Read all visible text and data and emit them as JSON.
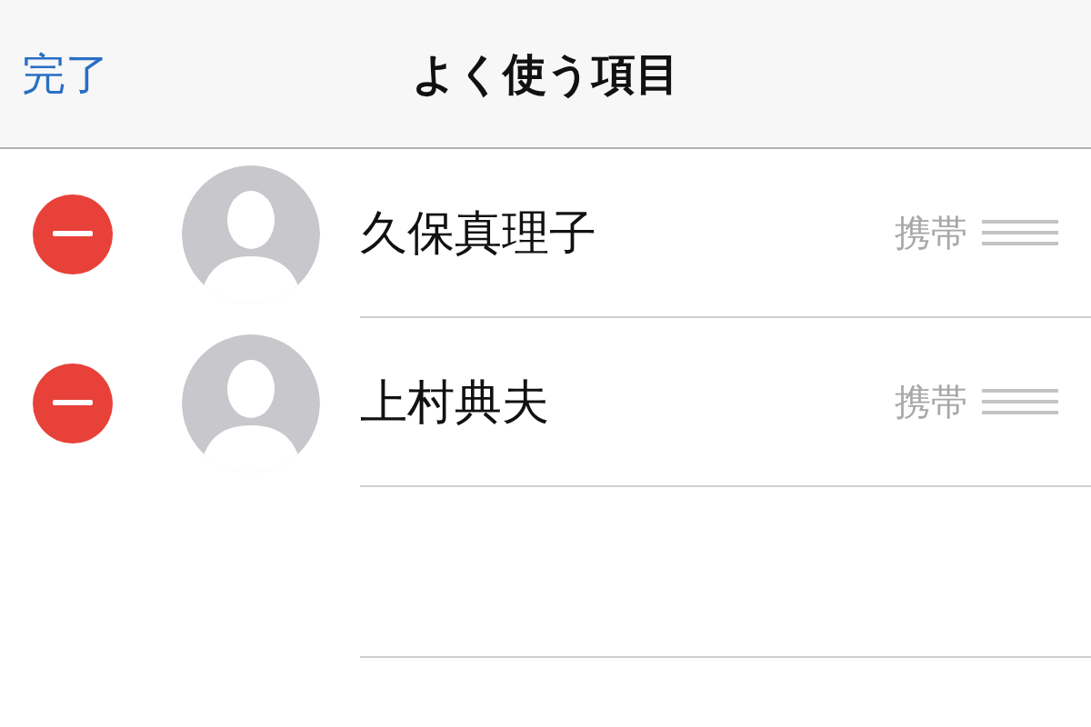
{
  "nav_bar": {
    "done_button": "完了",
    "title": "よく使う項目"
  },
  "favorites": [
    {
      "name": "久保真理子",
      "label": "携帯"
    },
    {
      "name": "上村典夫",
      "label": "携帯"
    }
  ]
}
